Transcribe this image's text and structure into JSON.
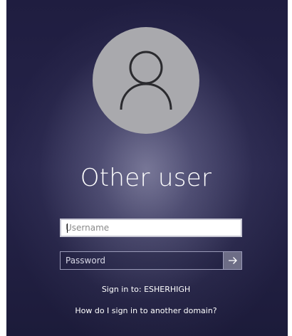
{
  "user": {
    "display_name": "Other user",
    "avatar_icon": "person-icon"
  },
  "form": {
    "username_placeholder": "Username",
    "password_placeholder": "Password",
    "submit_icon": "arrow-right-icon"
  },
  "sign_in_to": "Sign in to: ESHERHIGH",
  "domain_help_link": "How do I sign in to another domain?",
  "colors": {
    "background": "#221f45",
    "avatar_circle": "#a9a9ad",
    "submit_button": "#6d6d86",
    "text": "#ffffff"
  }
}
